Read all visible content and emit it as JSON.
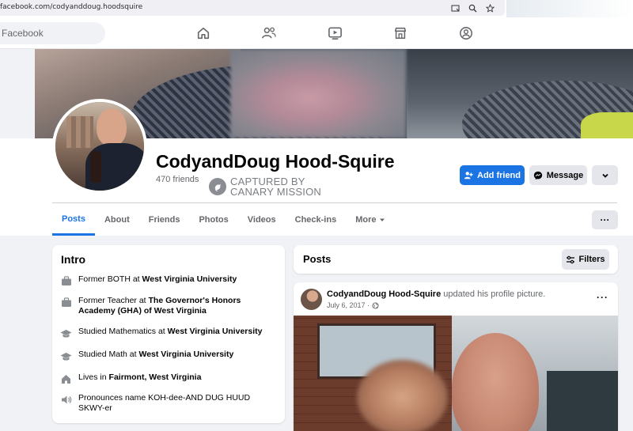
{
  "browser": {
    "url": "facebook.com/codyanddoug.hoodsquire"
  },
  "topnav": {
    "search_placeholder": "Facebook",
    "icons": [
      "home-icon",
      "friends-icon",
      "video-icon",
      "marketplace-icon",
      "groups-icon"
    ]
  },
  "profile": {
    "name": "CodyandDoug Hood-Squire",
    "friends": "470 friends",
    "buttons": {
      "add_friend": "Add friend",
      "message": "Message"
    }
  },
  "watermark": {
    "line1": "CAPTURED BY",
    "line2": "CANARY MISSION"
  },
  "tabs": [
    "Posts",
    "About",
    "Friends",
    "Photos",
    "Videos",
    "Check-ins",
    "More"
  ],
  "intro": {
    "title": "Intro",
    "items": [
      {
        "icon": "briefcase-icon",
        "prefix": "Former BOTH at ",
        "bold": "West Virginia University",
        "suffix": ""
      },
      {
        "icon": "briefcase-icon",
        "prefix": "Former Teacher at ",
        "bold": "The Governor's Honors Academy (GHA) of West Virginia",
        "suffix": ""
      },
      {
        "icon": "graduation-cap-icon",
        "prefix": "Studied Mathematics at ",
        "bold": "West Virginia University",
        "suffix": ""
      },
      {
        "icon": "graduation-cap-icon",
        "prefix": "Studied Math at ",
        "bold": "West Virginia University",
        "suffix": ""
      },
      {
        "icon": "home-icon",
        "prefix": "Lives in ",
        "bold": "Fairmont, West Virginia",
        "suffix": ""
      },
      {
        "icon": "speaker-icon",
        "prefix": "Pronounces name KOH-dee-AND DUG HUUD SKWY-er",
        "bold": "",
        "suffix": ""
      }
    ]
  },
  "posts": {
    "title": "Posts",
    "filters_label": "Filters"
  },
  "post": {
    "author": "CodyandDoug Hood-Squire",
    "action": "updated his profile picture.",
    "date": "July 6, 2017 ·"
  },
  "colors": {
    "accent": "#1b74e4",
    "background": "#f0f2f5"
  }
}
